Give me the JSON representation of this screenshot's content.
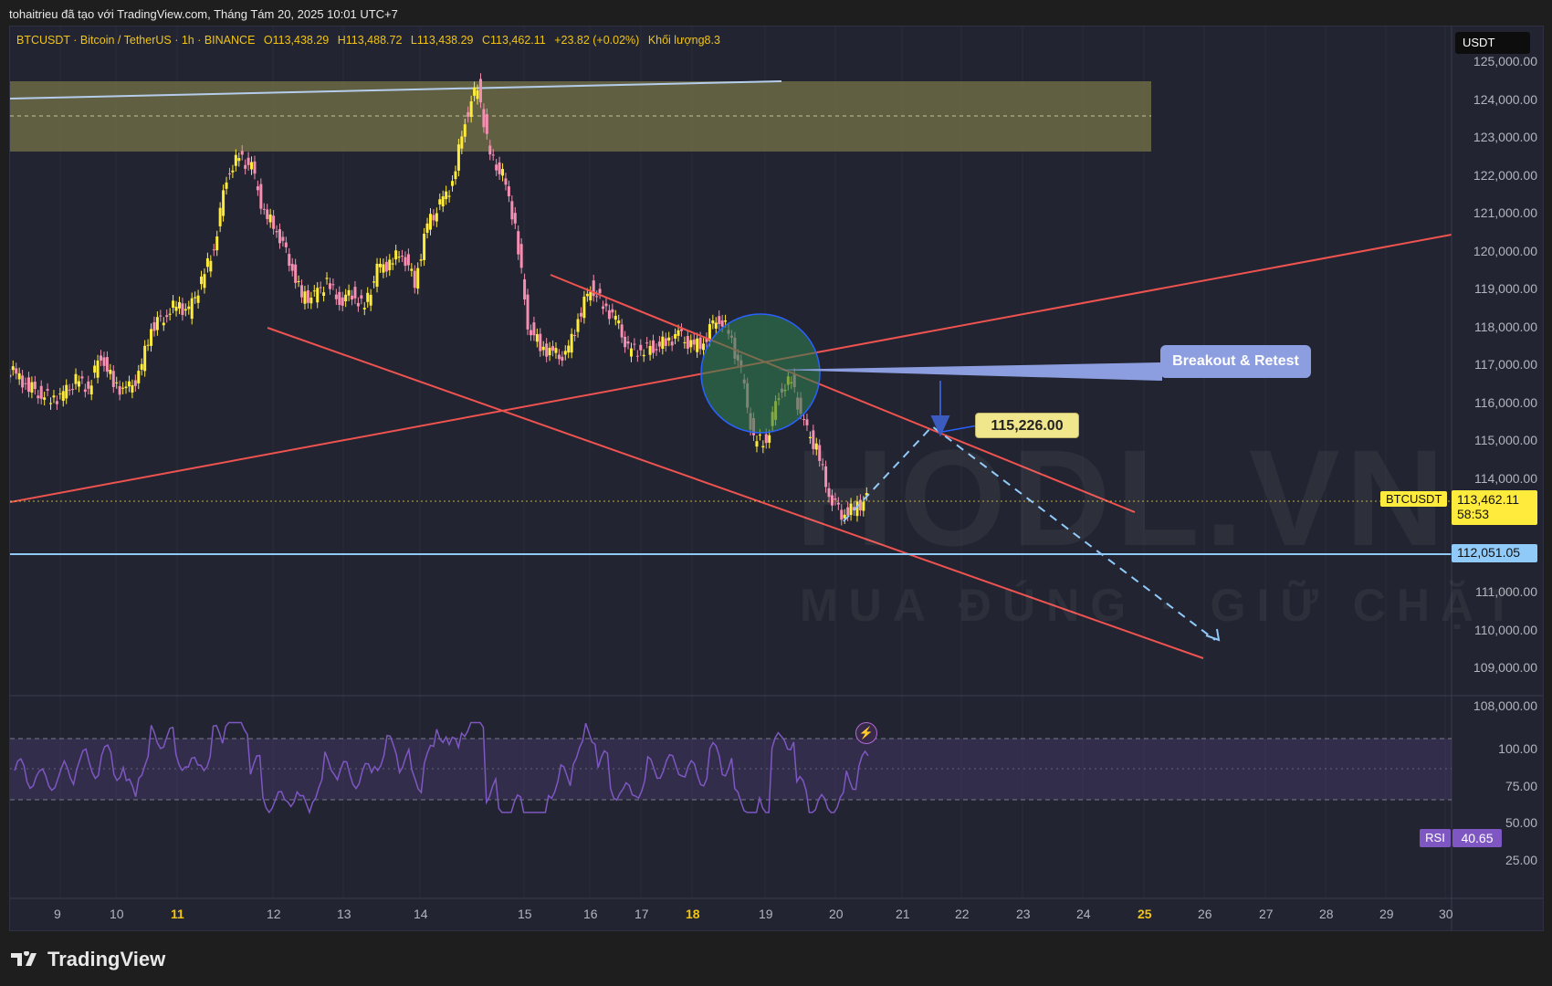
{
  "caption": "tohaitrieu đã tạo với TradingView.com, Tháng Tám 20, 2025 10:01 UTC+7",
  "symbol_line": {
    "symbol": "BTCUSDT · Bitcoin / TetherUS · 1h · BINANCE",
    "open": "O113,438.29",
    "high": "H113,488.72",
    "low": "L113,438.29",
    "close": "C113,462.11",
    "change": "+23.82 (+0.02%)",
    "volume": "Khối lượng8.3"
  },
  "currency": "USDT",
  "price_labels": [
    "125,000.00",
    "124,000.00",
    "123,000.00",
    "122,000.00",
    "121,000.00",
    "120,000.00",
    "119,000.00",
    "118,000.00",
    "117,000.00",
    "116,000.00",
    "115,000.00",
    "114,000.00",
    "111,000.00",
    "110,000.00",
    "109,000.00",
    "108,000.00"
  ],
  "rsi_labels": [
    "100.00",
    "75.00",
    "50.00",
    "25.00"
  ],
  "date_labels": [
    {
      "text": "9",
      "bold": false
    },
    {
      "text": "10",
      "bold": false
    },
    {
      "text": "11",
      "bold": true
    },
    {
      "text": "12",
      "bold": false
    },
    {
      "text": "13",
      "bold": false
    },
    {
      "text": "14",
      "bold": false
    },
    {
      "text": "15",
      "bold": false
    },
    {
      "text": "16",
      "bold": false
    },
    {
      "text": "17",
      "bold": false
    },
    {
      "text": "18",
      "bold": true
    },
    {
      "text": "19",
      "bold": false
    },
    {
      "text": "20",
      "bold": false
    },
    {
      "text": "21",
      "bold": false
    },
    {
      "text": "22",
      "bold": false
    },
    {
      "text": "23",
      "bold": false
    },
    {
      "text": "24",
      "bold": false
    },
    {
      "text": "25",
      "bold": true
    },
    {
      "text": "26",
      "bold": false
    },
    {
      "text": "27",
      "bold": false
    },
    {
      "text": "28",
      "bold": false
    },
    {
      "text": "29",
      "bold": false
    },
    {
      "text": "30",
      "bold": false
    }
  ],
  "current_price": {
    "tag": "BTCUSDT",
    "price": "113,462.11",
    "countdown": "58:53"
  },
  "support_price": "112,051.05",
  "target_label": "115,226.00",
  "annotation": "Breakout & Retest",
  "rsi": {
    "tag": "RSI",
    "value": "40.65"
  },
  "watermark": {
    "main": "HODL.VN",
    "sub": "MUA ĐÚNG · GIỮ CHẶT"
  },
  "brand": "TradingView",
  "colors": {
    "bull": "#ffeb3b",
    "bear": "#f48fb1",
    "trendline": "#ef5350",
    "support": "#90caf9",
    "zone": "#6b6a45",
    "rsi_line": "#7e57c2",
    "accent": "#f0c419"
  },
  "price_series": [
    116800,
    116500,
    116300,
    116100,
    116200,
    116600,
    116400,
    117300,
    116500,
    116300,
    116700,
    118000,
    118300,
    118600,
    118400,
    119200,
    120100,
    122000,
    122500,
    122200,
    121000,
    120600,
    119800,
    118800,
    118800,
    119200,
    118700,
    118900,
    118500,
    119500,
    119700,
    120000,
    119200,
    120700,
    121200,
    121800,
    123500,
    124400,
    122500,
    122000,
    120700,
    118100,
    117500,
    117300,
    117200,
    118200,
    119100,
    118600,
    118200,
    117400,
    117400,
    117500,
    117600,
    117800,
    117500,
    117600,
    118300,
    117900,
    116800,
    115000,
    115000,
    116300,
    116600,
    115400,
    114800,
    113600,
    113100,
    113200,
    113462
  ]
}
